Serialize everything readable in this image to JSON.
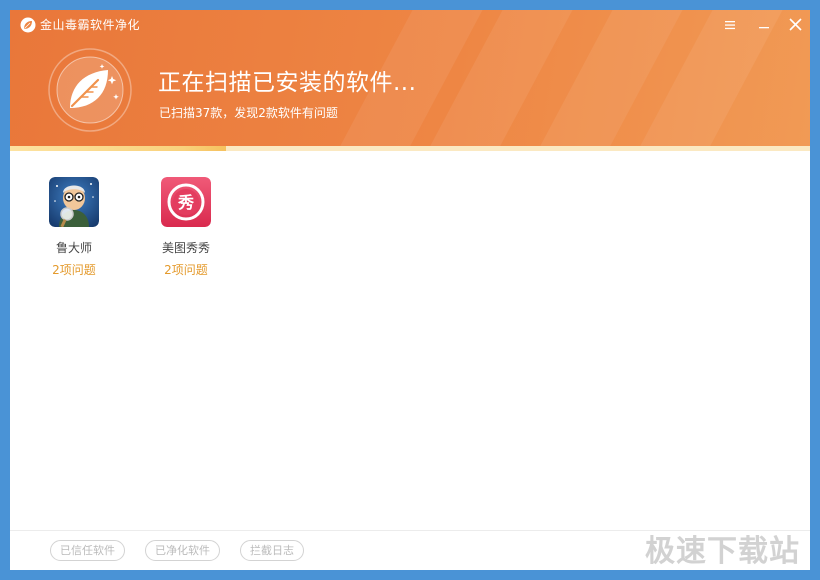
{
  "window": {
    "title": "金山毒霸软件净化",
    "menu_icon": "hamburger-icon",
    "minimize_icon": "minimize-icon",
    "close_icon": "close-icon"
  },
  "scan": {
    "title": "正在扫描已安装的软件...",
    "subtitle": "已扫描37款，发现2款软件有问题",
    "progress_fraction": 0.27
  },
  "apps": [
    {
      "name": "鲁大师",
      "issues": "2项问题",
      "icon": "ludashi-icon"
    },
    {
      "name": "美图秀秀",
      "issues": "2项问题",
      "icon": "meitu-xiuxiu-icon"
    }
  ],
  "footer": {
    "trusted_label": "已信任软件",
    "cleaned_label": "已净化软件",
    "log_label": "拦截日志"
  },
  "watermark": "极速下载站",
  "colors": {
    "header": "#ee8644",
    "accent_issue": "#e49a2c",
    "background": "#ffffff"
  }
}
